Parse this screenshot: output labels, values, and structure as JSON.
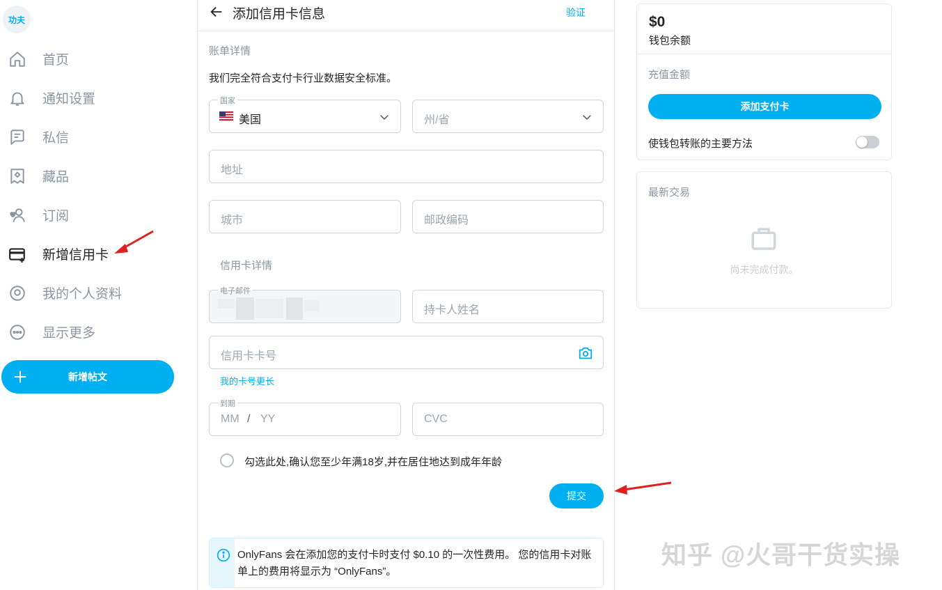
{
  "sidebar": {
    "avatar_text": "功夫",
    "items": [
      {
        "label": "首页",
        "icon": "home-icon"
      },
      {
        "label": "通知设置",
        "icon": "bell-icon"
      },
      {
        "label": "私信",
        "icon": "message-icon"
      },
      {
        "label": "藏品",
        "icon": "collections-icon"
      },
      {
        "label": "订阅",
        "icon": "subscriptions-icon"
      },
      {
        "label": "新增信用卡",
        "icon": "add-card-icon",
        "active": true
      },
      {
        "label": "我的个人资料",
        "icon": "profile-icon"
      },
      {
        "label": "显示更多",
        "icon": "more-icon"
      }
    ],
    "new_post_label": "新增帖文"
  },
  "header": {
    "title": "添加信用卡信息",
    "verify_label": "验证"
  },
  "billing": {
    "section_title": "账单详情",
    "compliance_text": "我们完全符合支付卡行业数据安全标准。",
    "country_label": "国家",
    "country_value": "美国",
    "state_placeholder": "州/省",
    "address_placeholder": "地址",
    "city_placeholder": "城市",
    "zip_placeholder": "邮政编码"
  },
  "card": {
    "section_title": "信用卡详情",
    "email_label": "电子邮件",
    "cardholder_placeholder": "持卡人姓名",
    "card_number_placeholder": "信用卡卡号",
    "long_card_link": "我的卡号更长",
    "expiry_label": "到期",
    "expiry_mm": "MM",
    "expiry_sep": "/",
    "expiry_yy": "YY",
    "cvc_placeholder": "CVC",
    "age_confirm_text": "勾选此处,确认您至少年满18岁,并在居住地达到成年年龄",
    "submit_label": "提交",
    "info_text": "OnlyFans 会在添加您的支付卡时支付 $0.10 的一次性费用。 您的信用卡对账单上的费用将显示为 “OnlyFans”。"
  },
  "wallet": {
    "balance": "$0",
    "balance_label": "钱包余额",
    "recharge_label": "充值金额",
    "add_card_button": "添加支付卡",
    "primary_method_label": "使钱包转账的主要方法",
    "toggle_on": false
  },
  "transactions": {
    "title": "最新交易",
    "empty_text": "尚未完成付款。"
  },
  "watermark": "知乎 @火哥干货实操",
  "colors": {
    "accent": "#00aff0",
    "annotation_arrow": "#e02020"
  }
}
